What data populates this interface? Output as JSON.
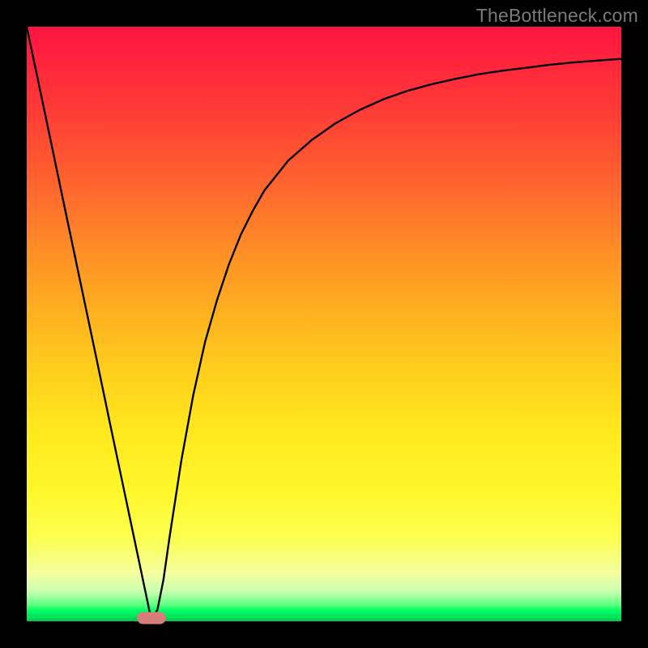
{
  "watermark": "TheBottleneck.com",
  "colors": {
    "frame": "#000000",
    "curve": "#000000",
    "marker": "#d97d7a"
  },
  "chart_data": {
    "type": "line",
    "title": "",
    "xlabel": "",
    "ylabel": "",
    "xlim": [
      0,
      100
    ],
    "ylim": [
      0,
      100
    ],
    "grid": false,
    "series": [
      {
        "name": "bottleneck-curve",
        "x": [
          0,
          2,
          4,
          6,
          8,
          10,
          12,
          14,
          16,
          18,
          20,
          21,
          22,
          23,
          24,
          26,
          28,
          30,
          32,
          34,
          36,
          38,
          40,
          44,
          48,
          52,
          56,
          60,
          64,
          68,
          72,
          76,
          80,
          84,
          88,
          92,
          96,
          100
        ],
        "values": [
          100,
          90.5,
          81.0,
          71.4,
          61.9,
          52.4,
          42.9,
          33.3,
          23.8,
          14.3,
          4.8,
          0.0,
          2.0,
          7.0,
          14.0,
          27.0,
          38.0,
          47.0,
          54.0,
          60.0,
          65.0,
          69.0,
          72.5,
          77.5,
          81.0,
          83.8,
          86.0,
          87.8,
          89.2,
          90.3,
          91.2,
          92.0,
          92.6,
          93.1,
          93.6,
          94.0,
          94.3,
          94.6
        ]
      }
    ],
    "annotations": [
      {
        "name": "min-marker",
        "x": 21,
        "y": 0
      }
    ]
  }
}
